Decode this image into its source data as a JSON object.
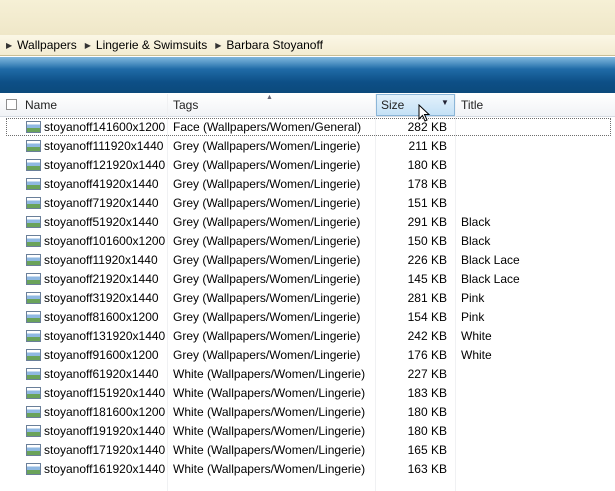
{
  "breadcrumb": [
    "Wallpapers",
    "Lingerie & Swimsuits",
    "Barbara Stoyanoff"
  ],
  "columns": {
    "name": "Name",
    "tags": "Tags",
    "size": "Size",
    "title": "Title"
  },
  "sort": {
    "column": "Tags",
    "direction": "ascending"
  },
  "focused_row": 0,
  "files": [
    {
      "name": "stoyanoff141600x1200",
      "tags": "Face (Wallpapers/Women/General)",
      "size": "282 KB",
      "title": ""
    },
    {
      "name": "stoyanoff111920x1440",
      "tags": "Grey (Wallpapers/Women/Lingerie)",
      "size": "211 KB",
      "title": ""
    },
    {
      "name": "stoyanoff121920x1440",
      "tags": "Grey (Wallpapers/Women/Lingerie)",
      "size": "180 KB",
      "title": ""
    },
    {
      "name": "stoyanoff41920x1440",
      "tags": "Grey (Wallpapers/Women/Lingerie)",
      "size": "178 KB",
      "title": ""
    },
    {
      "name": "stoyanoff71920x1440",
      "tags": "Grey (Wallpapers/Women/Lingerie)",
      "size": "151 KB",
      "title": ""
    },
    {
      "name": "stoyanoff51920x1440",
      "tags": "Grey (Wallpapers/Women/Lingerie)",
      "size": "291 KB",
      "title": "Black"
    },
    {
      "name": "stoyanoff101600x1200",
      "tags": "Grey (Wallpapers/Women/Lingerie)",
      "size": "150 KB",
      "title": "Black"
    },
    {
      "name": "stoyanoff11920x1440",
      "tags": "Grey (Wallpapers/Women/Lingerie)",
      "size": "226 KB",
      "title": "Black Lace"
    },
    {
      "name": "stoyanoff21920x1440",
      "tags": "Grey (Wallpapers/Women/Lingerie)",
      "size": "145 KB",
      "title": "Black Lace"
    },
    {
      "name": "stoyanoff31920x1440",
      "tags": "Grey (Wallpapers/Women/Lingerie)",
      "size": "281 KB",
      "title": "Pink"
    },
    {
      "name": "stoyanoff81600x1200",
      "tags": "Grey (Wallpapers/Women/Lingerie)",
      "size": "154 KB",
      "title": "Pink"
    },
    {
      "name": "stoyanoff131920x1440",
      "tags": "Grey (Wallpapers/Women/Lingerie)",
      "size": "242 KB",
      "title": "White"
    },
    {
      "name": "stoyanoff91600x1200",
      "tags": "Grey (Wallpapers/Women/Lingerie)",
      "size": "176 KB",
      "title": "White"
    },
    {
      "name": "stoyanoff61920x1440",
      "tags": "White (Wallpapers/Women/Lingerie)",
      "size": "227 KB",
      "title": ""
    },
    {
      "name": "stoyanoff151920x1440",
      "tags": "White (Wallpapers/Women/Lingerie)",
      "size": "183 KB",
      "title": ""
    },
    {
      "name": "stoyanoff181600x1200",
      "tags": "White (Wallpapers/Women/Lingerie)",
      "size": "180 KB",
      "title": ""
    },
    {
      "name": "stoyanoff191920x1440",
      "tags": "White (Wallpapers/Women/Lingerie)",
      "size": "180 KB",
      "title": ""
    },
    {
      "name": "stoyanoff171920x1440",
      "tags": "White (Wallpapers/Women/Lingerie)",
      "size": "165 KB",
      "title": ""
    },
    {
      "name": "stoyanoff161920x1440",
      "tags": "White (Wallpapers/Women/Lingerie)",
      "size": "163 KB",
      "title": ""
    }
  ],
  "icons": {
    "separator": "chevron-right-icon",
    "file": "image-file-icon",
    "sort": "sort-up-icon",
    "dropdown": "dropdown-arrow-icon",
    "cursor": "mouse-pointer-icon"
  }
}
